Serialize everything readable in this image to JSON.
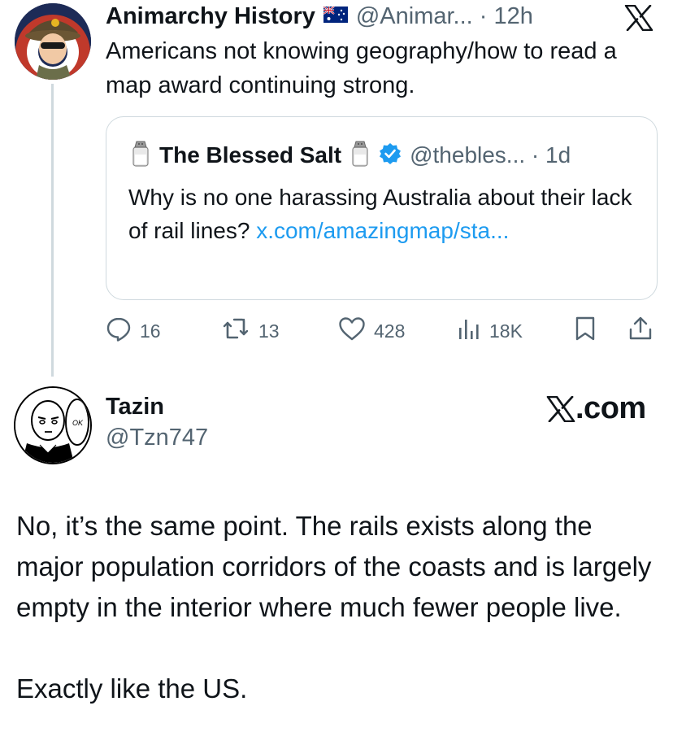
{
  "tweet1": {
    "name": "Animarchy History",
    "handle_time": "@Animar... · 12h",
    "text": "Americans not knowing geography/how to read a map award continuing strong.",
    "flag_icon": "australia-flag-icon",
    "platform_icon": "x-logo-icon"
  },
  "quote": {
    "name": "The Blessed Salt",
    "handle_time": "@thebles... · 1d",
    "text_before_link": "Why is no one harassing Australia about their lack of rail lines? ",
    "link": "x.com/amazingmap/sta...",
    "verified_color": "#1d9bf0"
  },
  "actions": {
    "replies": "16",
    "retweets": "13",
    "likes": "428",
    "views": "18K"
  },
  "tweet2": {
    "name": "Tazin",
    "handle": "@Tzn747",
    "brand": ".com",
    "para1": "No, it’s the same point. The rails exists along the major population corridors of the coasts and is largely empty in the interior where much fewer people live.",
    "para2": "Exactly like the US.",
    "avatar_caption": "OK"
  },
  "colors": {
    "text": "#0f1419",
    "secondary": "#536471",
    "link": "#1d9bf0",
    "border": "#cfd9de"
  }
}
